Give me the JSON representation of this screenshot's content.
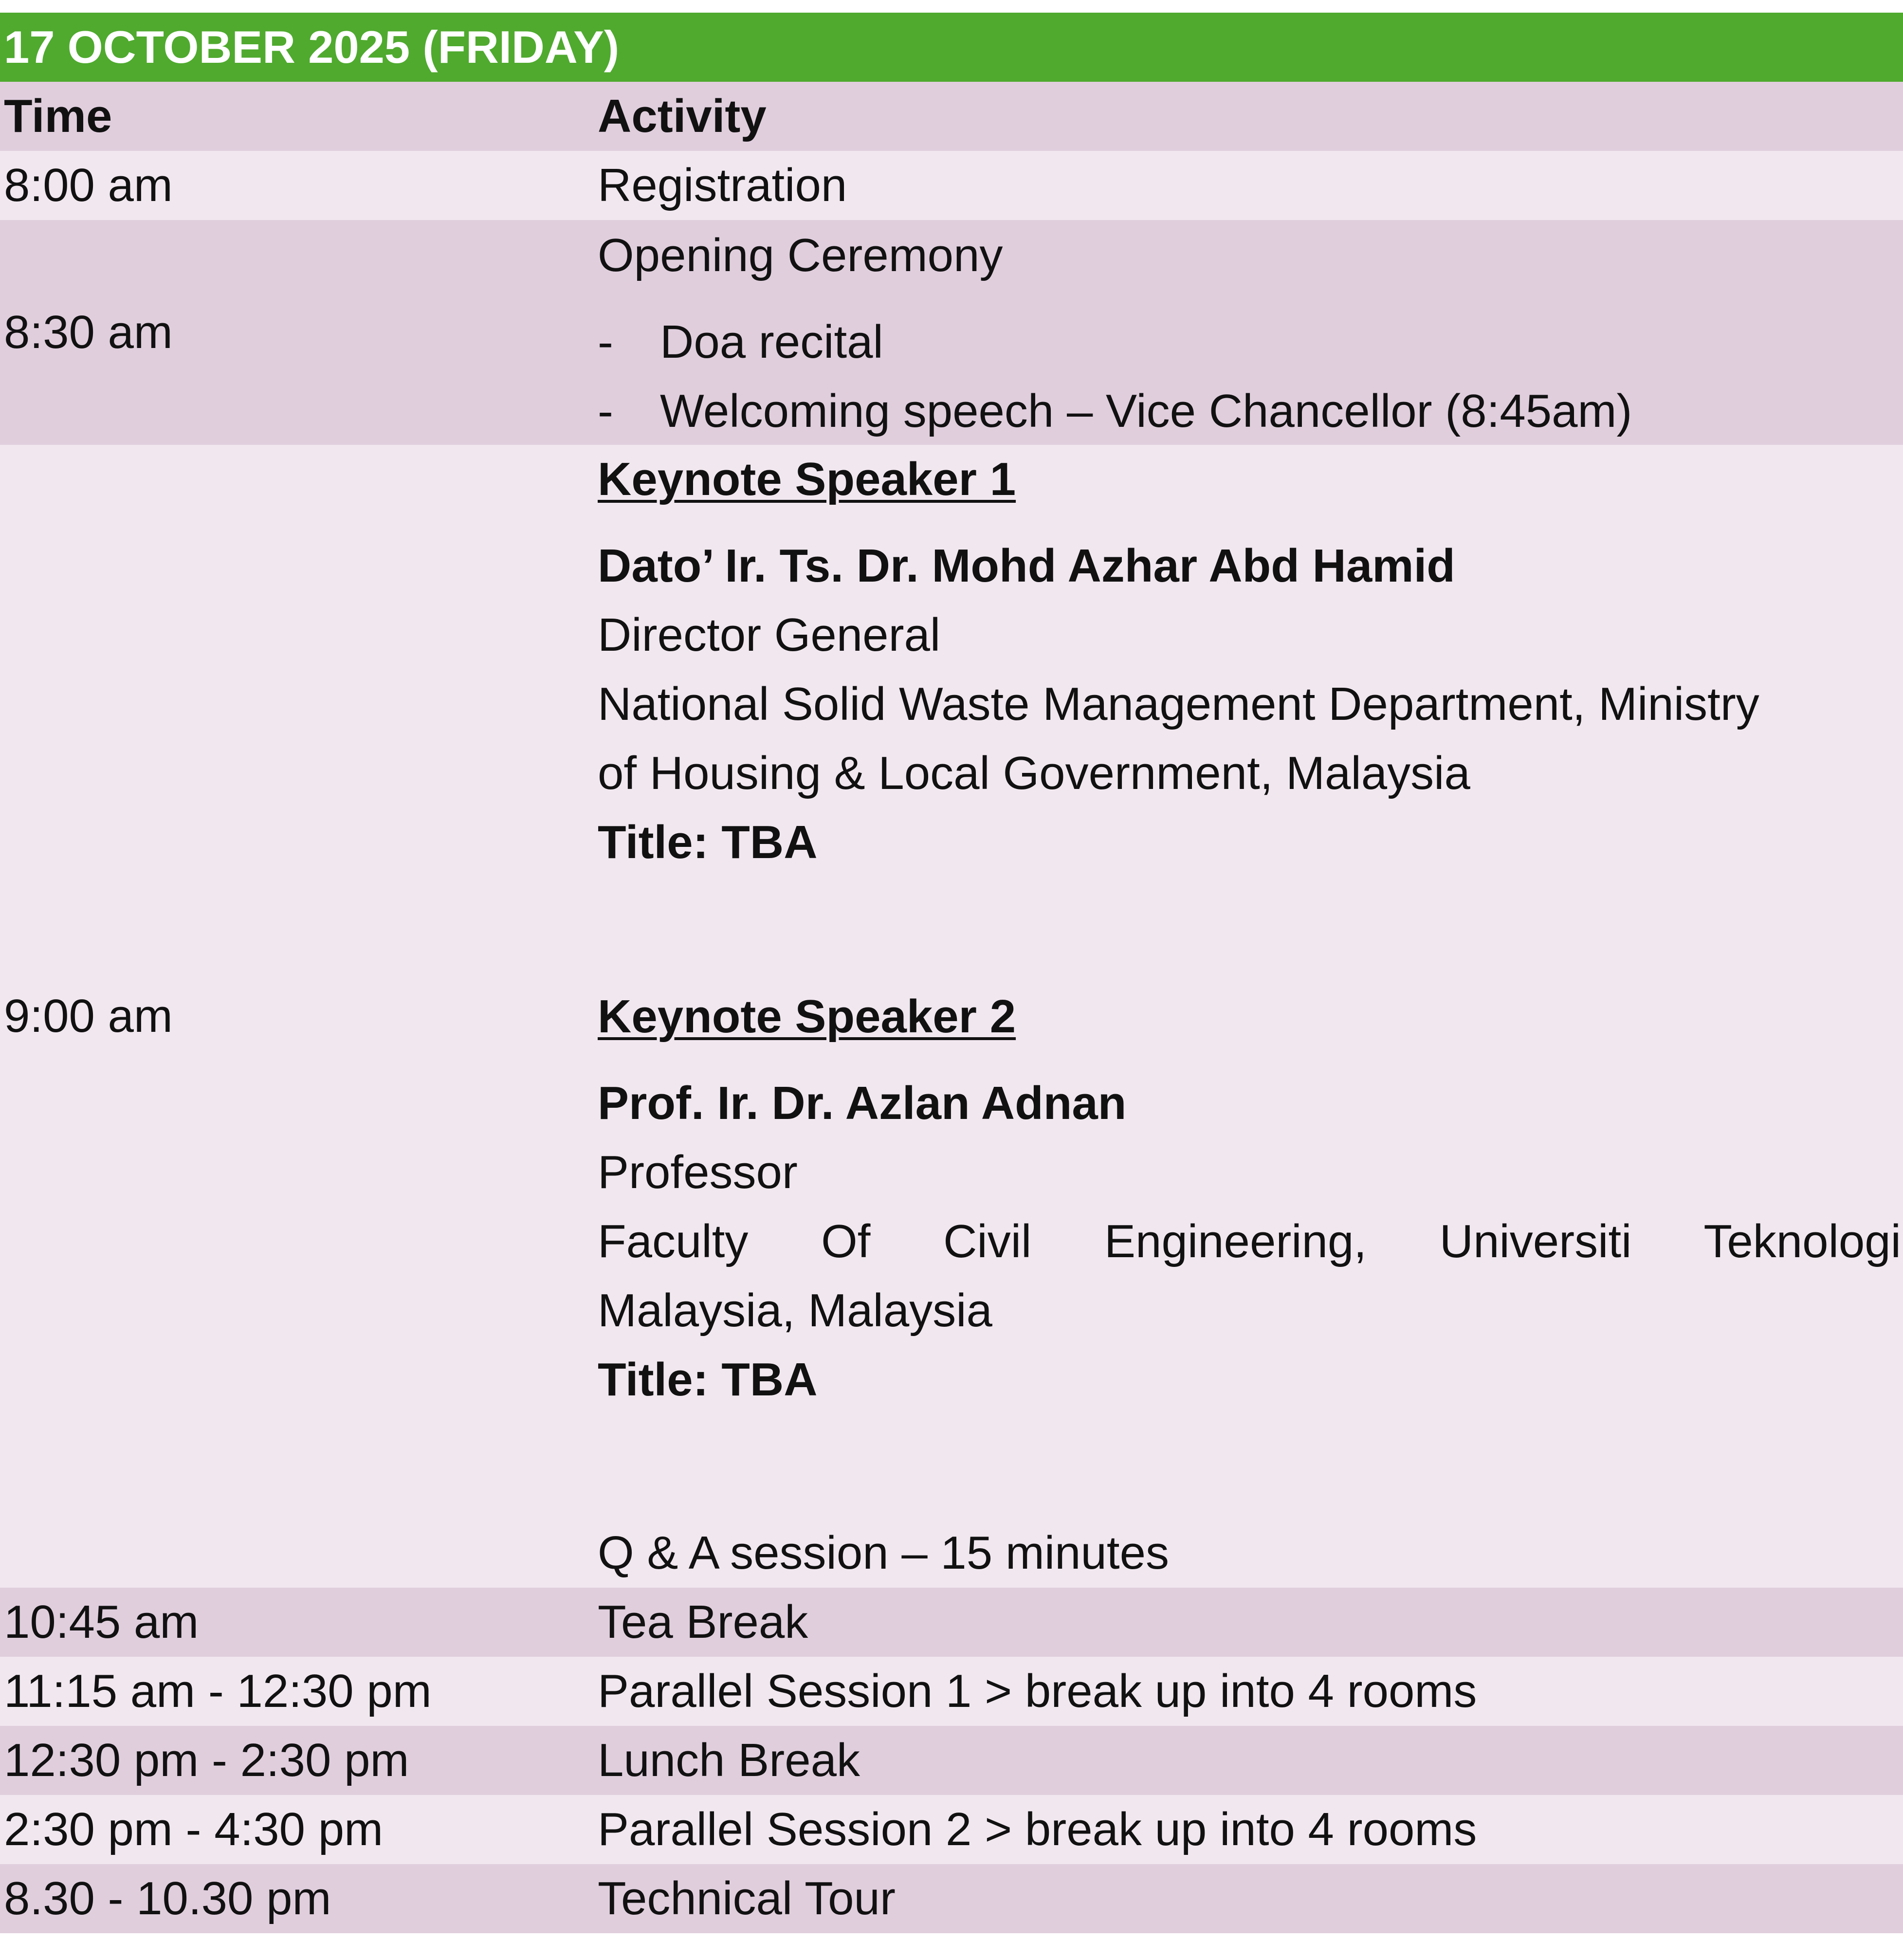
{
  "date_header": "17 OCTOBER 2025 (FRIDAY)",
  "columns": {
    "time": "Time",
    "activity": "Activity"
  },
  "rows": {
    "registration": {
      "time": "8:00 am",
      "activity": "Registration"
    },
    "opening": {
      "time": "8:30 am",
      "activity": "Opening Ceremony",
      "bullets": [
        {
          "dash": "-",
          "text": "Doa recital"
        },
        {
          "dash": "-",
          "text": "Welcoming speech – Vice Chancellor (8:45am)"
        }
      ]
    },
    "keynote": {
      "time": "9:00 am",
      "speaker1": {
        "heading": "Keynote Speaker 1",
        "name": "Dato’ Ir. Ts. Dr. Mohd Azhar Abd Hamid",
        "position": "Director General",
        "affiliation_line1": "National Solid Waste Management Department, Ministry",
        "affiliation_line2": "of Housing & Local Government, Malaysia",
        "title": "Title: TBA"
      },
      "speaker2": {
        "heading": "Keynote Speaker 2",
        "name": "Prof. Ir. Dr. Azlan Adnan",
        "position": "Professor",
        "affiliation_line1": "Faculty Of Civil Engineering, Universiti Teknologi",
        "affiliation_line2": "Malaysia, Malaysia",
        "title": "Title: TBA"
      },
      "qa": "Q & A session – 15 minutes"
    },
    "tea": {
      "time": "10:45 am",
      "activity": "Tea Break"
    },
    "parallel1": {
      "time": "11:15 am - 12:30 pm",
      "activity": "Parallel Session 1 > break up into 4 rooms"
    },
    "lunch": {
      "time": "12:30 pm - 2:30 pm",
      "activity": "Lunch Break"
    },
    "parallel2": {
      "time": "2:30 pm - 4:30 pm",
      "activity": "Parallel Session 2 > break up into 4 rooms"
    },
    "tour": {
      "time": "8.30 - 10.30 pm",
      "activity": "Technical Tour"
    }
  },
  "colors": {
    "header_green": "#4faa2e",
    "row_dark": "#e0cedd",
    "row_light": "#f1e8ef"
  }
}
